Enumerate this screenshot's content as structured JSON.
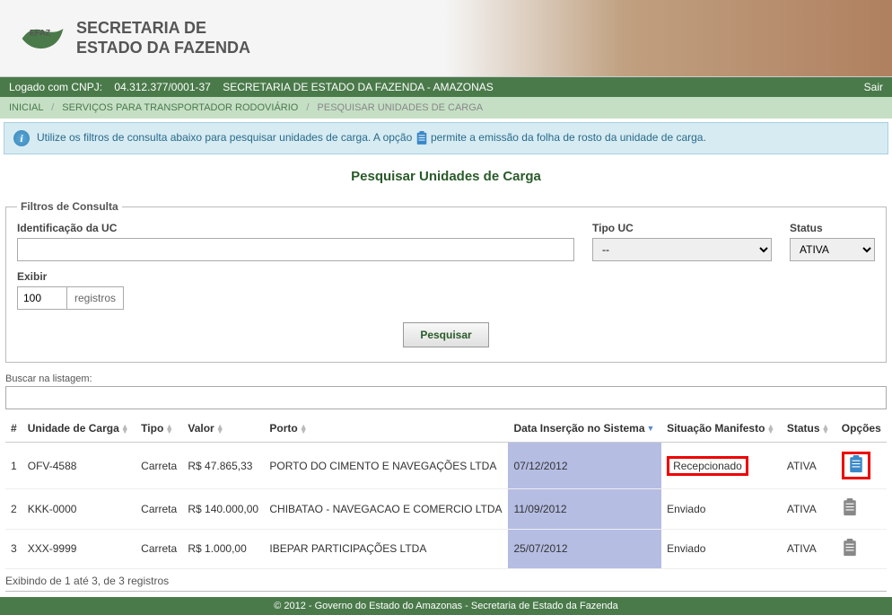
{
  "header": {
    "org_line1": "SECRETARIA DE",
    "org_line2": "ESTADO DA FAZENDA",
    "logo_text": "SEFAZ"
  },
  "topbar": {
    "logged_label": "Logado com CNPJ:",
    "cnpj": "04.312.377/0001-37",
    "org": "SECRETARIA DE ESTADO DA FAZENDA - AMAZONAS",
    "logout": "Sair"
  },
  "breadcrumb": {
    "items": [
      "INICIAL",
      "SERVIÇOS PARA TRANSPORTADOR RODOVIÁRIO",
      "PESQUISAR UNIDADES DE CARGA"
    ]
  },
  "info": {
    "text_before": "Utilize os filtros de consulta abaixo para pesquisar unidades de carga. A opção ",
    "text_after": " permite a emissão da folha de rosto da unidade de carga."
  },
  "page_title": "Pesquisar Unidades de Carga",
  "filters": {
    "legend": "Filtros de Consulta",
    "id_label": "Identificação da UC",
    "id_value": "",
    "tipo_label": "Tipo UC",
    "tipo_value": "--",
    "status_label": "Status",
    "status_value": "ATIVA",
    "exibir_label": "Exibir",
    "exibir_value": "100",
    "exibir_suffix": "registros",
    "search_btn": "Pesquisar"
  },
  "listing": {
    "search_label": "Buscar na listagem:",
    "search_value": ""
  },
  "table": {
    "columns": [
      "#",
      "Unidade de Carga",
      "Tipo",
      "Valor",
      "Porto",
      "Data Inserção no Sistema",
      "Situação Manifesto",
      "Status",
      "Opções"
    ],
    "rows": [
      {
        "n": "1",
        "uc": "OFV-4588",
        "tipo": "Carreta",
        "valor": "R$ 47.865,33",
        "porto": "PORTO DO CIMENTO E NAVEGAÇÕES LTDA",
        "data": "07/12/2012",
        "situacao": "Recepcionado",
        "status": "ATIVA",
        "highlight": true
      },
      {
        "n": "2",
        "uc": "KKK-0000",
        "tipo": "Carreta",
        "valor": "R$ 140.000,00",
        "porto": "CHIBATAO - NAVEGACAO E COMERCIO LTDA",
        "data": "11/09/2012",
        "situacao": "Enviado",
        "status": "ATIVA",
        "highlight": false
      },
      {
        "n": "3",
        "uc": "XXX-9999",
        "tipo": "Carreta",
        "valor": "R$ 1.000,00",
        "porto": "IBEPAR PARTICIPAÇÕES LTDA",
        "data": "25/07/2012",
        "situacao": "Enviado",
        "status": "ATIVA",
        "highlight": false
      }
    ]
  },
  "results_footer": "Exibindo de 1 até 3, de 3 registros",
  "page_footer": "© 2012 - Governo do Estado do Amazonas - Secretaria de Estado da Fazenda"
}
